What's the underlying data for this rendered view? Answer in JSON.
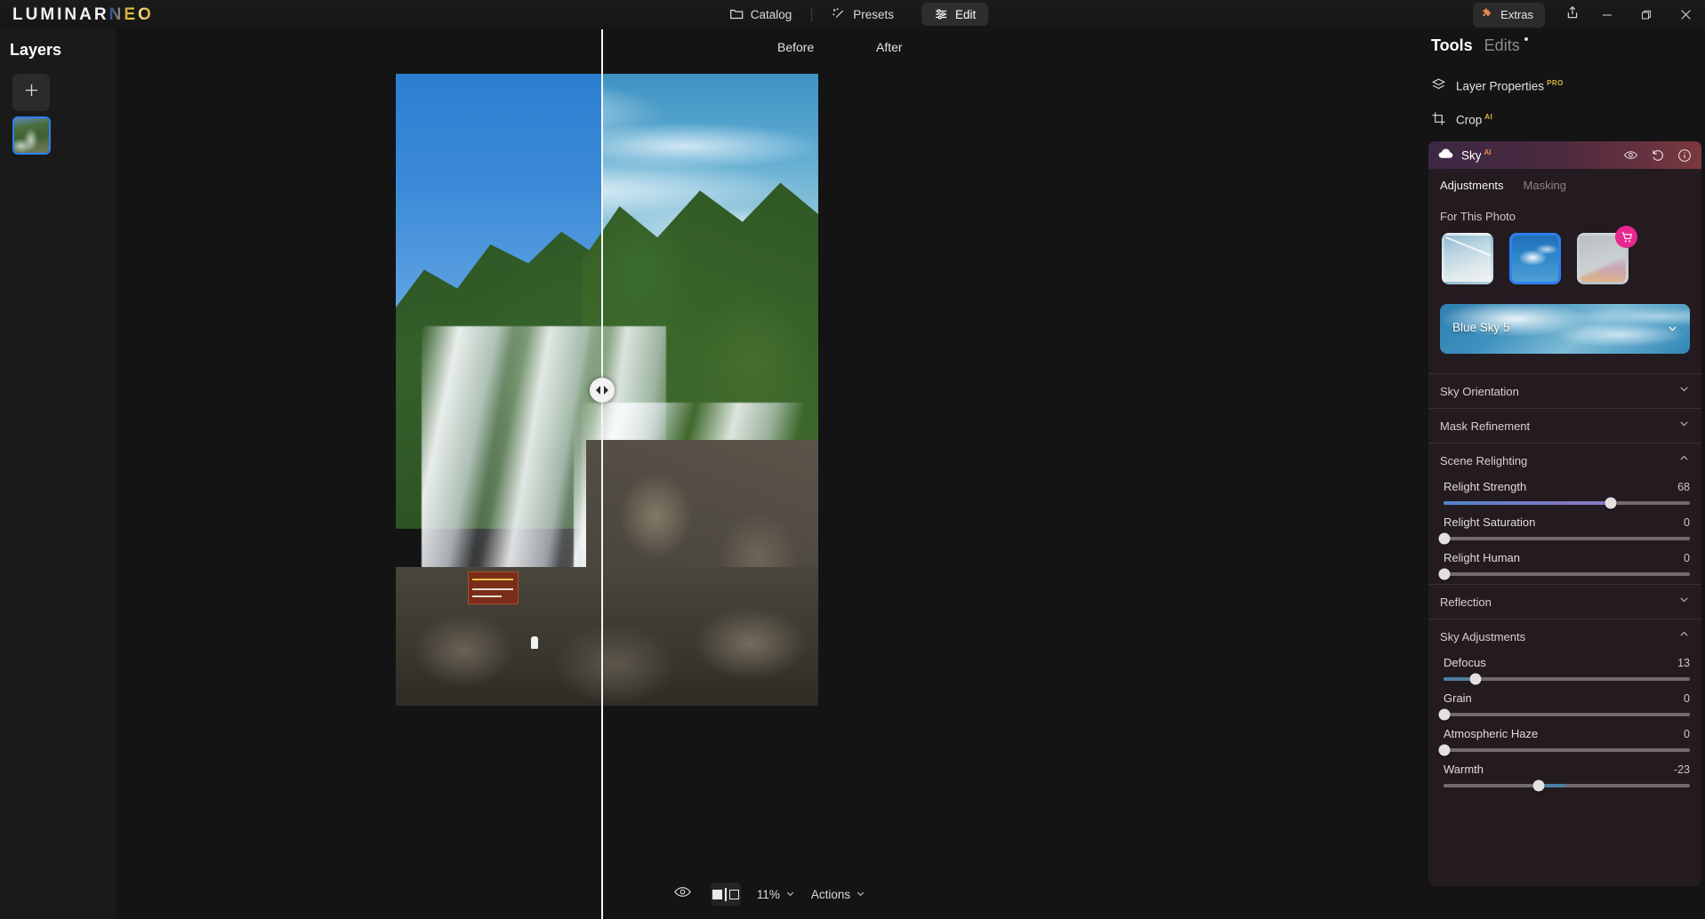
{
  "app": {
    "logo_main": "LUMINAR",
    "logo_accent": "NEO"
  },
  "titlebar": {
    "nav": [
      {
        "label": "Catalog",
        "icon": "folder-icon",
        "active": false
      },
      {
        "label": "Presets",
        "icon": "magic-wand-icon",
        "active": false
      },
      {
        "label": "Edit",
        "icon": "sliders-icon",
        "active": true
      }
    ],
    "extras_label": "Extras",
    "extras_icon": "puzzle-piece-icon",
    "share_icon": "share-icon",
    "window_controls": [
      "minimize-icon",
      "maximize-icon",
      "close-icon"
    ]
  },
  "layers": {
    "title": "Layers",
    "add_icon": "plus-icon",
    "items": [
      {
        "name": "waterfall-layer",
        "selected": true
      }
    ]
  },
  "canvas": {
    "before_label": "Before",
    "after_label": "After",
    "split_handle_icon": "compare-handle-icon"
  },
  "bottom_bar": {
    "eye_icon": "eye-icon",
    "compare_icon": "split-compare-icon",
    "zoom_level": "11%",
    "actions_label": "Actions",
    "chevron_icon": "chevron-down-icon"
  },
  "tools": {
    "tab_tools": "Tools",
    "tab_edits": "Edits",
    "rows": [
      {
        "label": "Layer Properties",
        "badge": "PRO",
        "icon": "layers-icon"
      },
      {
        "label": "Crop",
        "badge": "AI",
        "icon": "crop-icon"
      }
    ]
  },
  "sky_module": {
    "title": "Sky",
    "badge": "AI",
    "icon": "cloud-icon",
    "header_icons": [
      "eye-icon",
      "reset-icon",
      "info-icon"
    ],
    "sub_tabs": [
      {
        "label": "Adjustments",
        "active": true
      },
      {
        "label": "Masking",
        "active": false
      }
    ],
    "for_this_photo_label": "For This Photo",
    "thumbnails": [
      {
        "name": "sky-thumb-wispy",
        "selected": false,
        "locked": false
      },
      {
        "name": "sky-thumb-blue-clouds",
        "selected": true,
        "locked": false
      },
      {
        "name": "sky-thumb-rainbow",
        "selected": false,
        "locked": true,
        "badge_icon": "cart-icon"
      }
    ],
    "selected_sky": "Blue Sky 5",
    "sections": [
      {
        "label": "Sky Orientation",
        "expanded": false,
        "sliders": []
      },
      {
        "label": "Mask Refinement",
        "expanded": false,
        "sliders": []
      },
      {
        "label": "Scene Relighting",
        "expanded": true,
        "sliders": [
          {
            "label": "Relight Strength",
            "value": 68,
            "min": 0,
            "max": 100,
            "style": "purple"
          },
          {
            "label": "Relight Saturation",
            "value": 0,
            "min": 0,
            "max": 100,
            "style": "plain"
          },
          {
            "label": "Relight Human",
            "value": 0,
            "min": 0,
            "max": 100,
            "style": "plain"
          }
        ]
      },
      {
        "label": "Reflection",
        "expanded": false,
        "sliders": []
      },
      {
        "label": "Sky Adjustments",
        "expanded": true,
        "sliders": [
          {
            "label": "Defocus",
            "value": 13,
            "min": 0,
            "max": 100,
            "style": "blue"
          },
          {
            "label": "Grain",
            "value": 0,
            "min": 0,
            "max": 100,
            "style": "plain"
          },
          {
            "label": "Atmospheric Haze",
            "value": 0,
            "min": 0,
            "max": 100,
            "style": "plain"
          },
          {
            "label": "Warmth",
            "value": -23,
            "min": -100,
            "max": 100,
            "style": "bipolar"
          }
        ]
      }
    ]
  }
}
